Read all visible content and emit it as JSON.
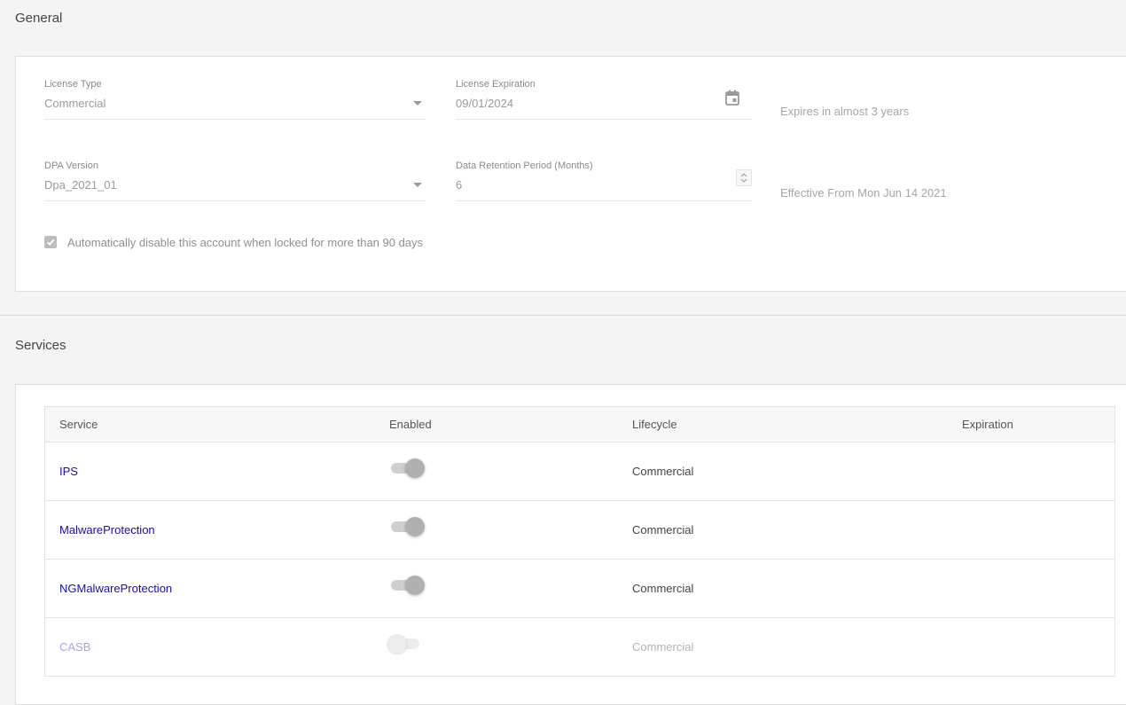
{
  "general": {
    "title": "General",
    "license_type": {
      "label": "License Type",
      "value": "Commercial"
    },
    "license_expiration": {
      "label": "License Expiration",
      "value": "09/01/2024",
      "hint": "Expires in almost 3 years"
    },
    "dpa_version": {
      "label": "DPA Version",
      "value": "Dpa_2021_01"
    },
    "data_retention": {
      "label": "Data Retention Period (Months)",
      "value": "6",
      "hint": "Effective From Mon Jun 14 2021"
    },
    "auto_disable": {
      "label": "Automatically disable this account when locked for more than 90 days",
      "checked": true
    }
  },
  "services": {
    "title": "Services",
    "columns": [
      "Service",
      "Enabled",
      "Lifecycle",
      "Expiration"
    ],
    "rows": [
      {
        "service": "IPS",
        "enabled": true,
        "lifecycle": "Commercial",
        "expiration": ""
      },
      {
        "service": "MalwareProtection",
        "enabled": true,
        "lifecycle": "Commercial",
        "expiration": ""
      },
      {
        "service": "NGMalwareProtection",
        "enabled": true,
        "lifecycle": "Commercial",
        "expiration": ""
      },
      {
        "service": "CASB",
        "enabled": false,
        "lifecycle": "Commercial",
        "expiration": ""
      }
    ]
  },
  "colors": {
    "link": "#1a0dab",
    "link_disabled": "#a9a6e6",
    "background": "#f4f4f4",
    "card": "#ffffff"
  }
}
